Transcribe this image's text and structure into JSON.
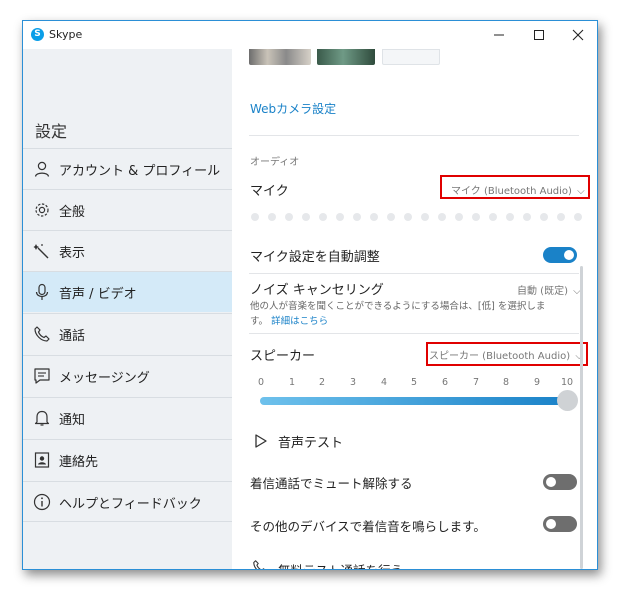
{
  "window": {
    "app_title": "Skype",
    "icon_letter": "S"
  },
  "sidebar": {
    "title": "設定",
    "items": [
      {
        "label": "アカウント & プロフィール",
        "icon": "user-icon"
      },
      {
        "label": "全般",
        "icon": "gear-icon"
      },
      {
        "label": "表示",
        "icon": "magic-wand-icon"
      },
      {
        "label": "音声 / ビデオ",
        "icon": "microphone-icon",
        "active": true
      },
      {
        "label": "通話",
        "icon": "phone-icon"
      },
      {
        "label": "メッセージング",
        "icon": "message-icon"
      },
      {
        "label": "通知",
        "icon": "bell-icon"
      },
      {
        "label": "連絡先",
        "icon": "contact-card-icon"
      },
      {
        "label": "ヘルプとフィードバック",
        "icon": "info-icon"
      }
    ]
  },
  "content": {
    "webcam_link": "Webカメラ設定",
    "audio_section": "オーディオ",
    "mic_label": "マイク",
    "mic_device": "マイク (Bluetooth Audio)",
    "auto_adjust_label": "マイク設定を自動調整",
    "auto_adjust_on": true,
    "noise_label": "ノイズ キャンセリング",
    "noise_value": "自動 (既定)",
    "noise_desc_line1": "他の人が音楽を聞くことができるようにする場合は、[低] を選択しま",
    "noise_desc_line2": "す。",
    "noise_detail_link": "詳細はこちら",
    "speaker_label": "スピーカー",
    "speaker_device": "スピーカー (Bluetooth Audio)",
    "volume_ticks": [
      "0",
      "1",
      "2",
      "3",
      "4",
      "5",
      "6",
      "7",
      "8",
      "9",
      "10"
    ],
    "volume_level": 10,
    "audio_test": "音声テスト",
    "unmute_label": "着信通話でミュート解除する",
    "unmute_on": false,
    "other_devices_label": "その他のデバイスで着信音を鳴らします。",
    "other_devices_on": false,
    "free_test_call": "無料テスト通話を行う"
  },
  "colors": {
    "accent": "#1a82c8",
    "highlight": "#e00000",
    "active_nav": "#d4eaf8",
    "toggle_off": "#6e6e6e"
  }
}
